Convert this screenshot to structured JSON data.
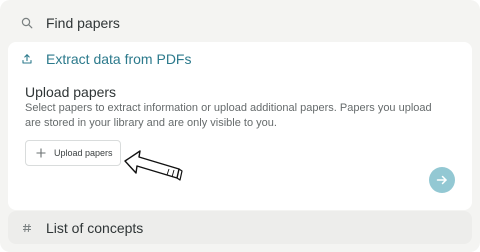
{
  "search": {
    "label": "Find papers"
  },
  "extract": {
    "title": "Extract data from PDFs",
    "upload_title": "Upload papers",
    "description": "Select papers to extract information or upload additional papers. Papers you upload are stored in your library and are only visible to you.",
    "upload_button": "Upload papers"
  },
  "concepts": {
    "label": "List of concepts"
  },
  "colors": {
    "accent": "#2c7a8c",
    "go_button": "#93c8d3",
    "background": "#f4f4f2"
  },
  "icons": {
    "search": "search-icon",
    "upload": "upload-icon",
    "plus": "plus-icon",
    "concepts": "hash-icon",
    "go": "arrow-right-icon",
    "annotation": "hand-drawn-arrow"
  }
}
